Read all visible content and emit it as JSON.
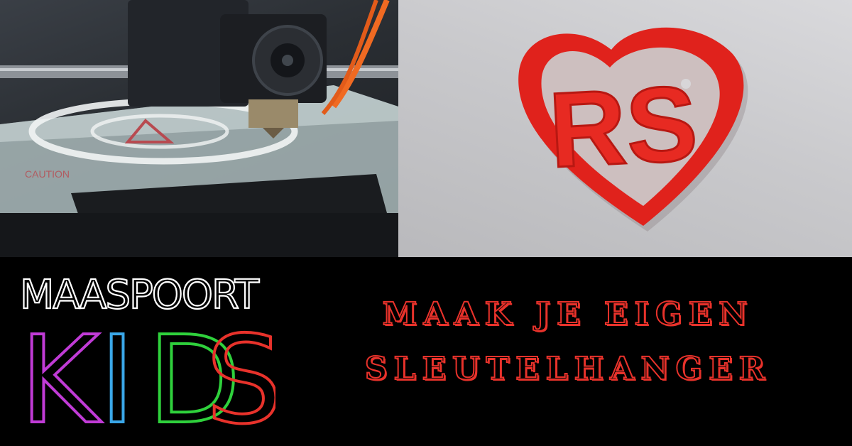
{
  "logo": {
    "line1": "MAASPOORT",
    "line2_letters": [
      "K",
      "I",
      "D",
      "S"
    ],
    "colors": {
      "outline": "#ffffff",
      "k": "#c03bd6",
      "i": "#3aa7e8",
      "d": "#2fd13c",
      "s": "#e8322b"
    }
  },
  "headline": {
    "line1": "MAAK JE EIGEN",
    "line2": "SLEUTELHANGER",
    "color": "#e8322b"
  },
  "photos": {
    "left_icon": "3d-printer-photo",
    "right_icon": "red-heart-keychain-photo",
    "keychain_letters": "RS"
  }
}
